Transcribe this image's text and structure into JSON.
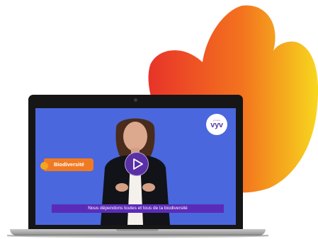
{
  "logo": {
    "small_text": "groupe",
    "text": "vyv"
  },
  "video": {
    "tag_label": "Biodiversité",
    "subtitle": "Nous dépendons toutes et tous de la biodiversité"
  },
  "colors": {
    "screen_background": "#4a67dd",
    "flame_start": "#e8332a",
    "flame_end": "#f7d71e",
    "tag_orange": "#f07a22",
    "accent_purple": "#5b2bb8"
  },
  "icons": {
    "play": "play-triangle-icon",
    "decoration": "flame-shape"
  }
}
